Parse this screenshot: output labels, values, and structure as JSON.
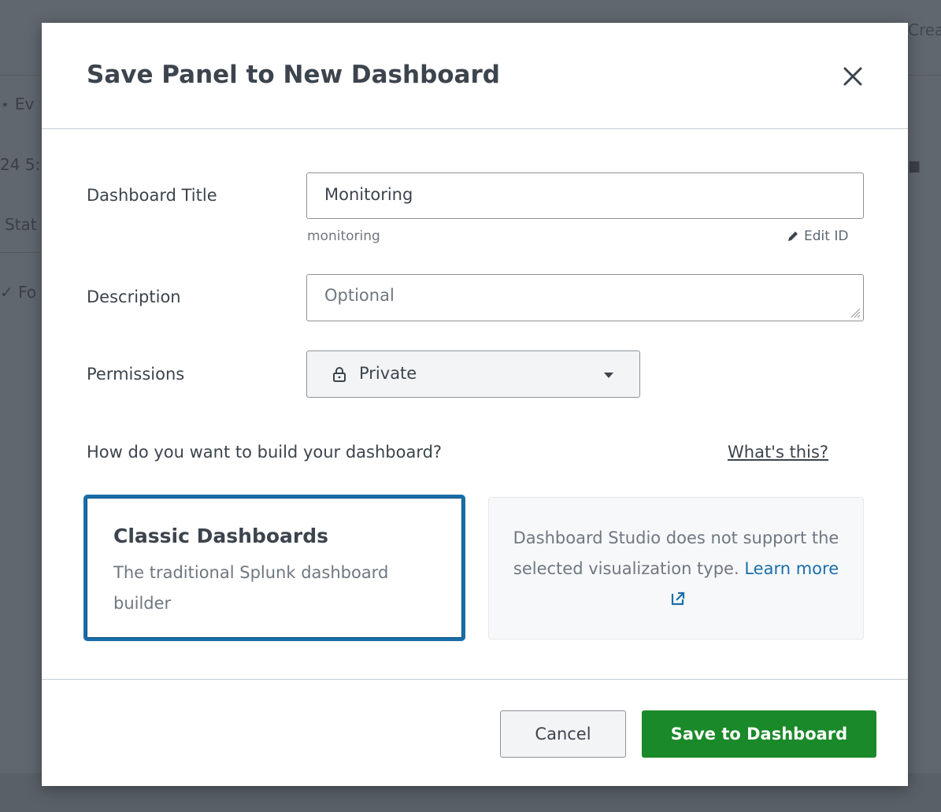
{
  "background": {
    "fragments": [
      "Crea",
      "Ev",
      "24 5:",
      "Stat",
      "Fo"
    ]
  },
  "modal": {
    "title": "Save Panel to New Dashboard",
    "close_icon": "close-icon",
    "fields": {
      "title_label": "Dashboard Title",
      "title_value": "Monitoring",
      "title_id": "monitoring",
      "edit_id_label": "Edit ID",
      "description_label": "Description",
      "description_placeholder": "Optional",
      "permissions_label": "Permissions",
      "permissions_value": "Private"
    },
    "build": {
      "question": "How do you want to build your dashboard?",
      "whats_this": "What's this?",
      "classic": {
        "title": "Classic Dashboards",
        "description": "The traditional Splunk dashboard builder"
      },
      "studio": {
        "message": "Dashboard Studio does not support the selected visualization type.",
        "learn_more": "Learn more"
      }
    },
    "footer": {
      "cancel_label": "Cancel",
      "save_label": "Save to Dashboard"
    }
  },
  "colors": {
    "accent_blue": "#1a6ea8",
    "primary_green": "#1a8929",
    "overlay": "#61676f"
  }
}
